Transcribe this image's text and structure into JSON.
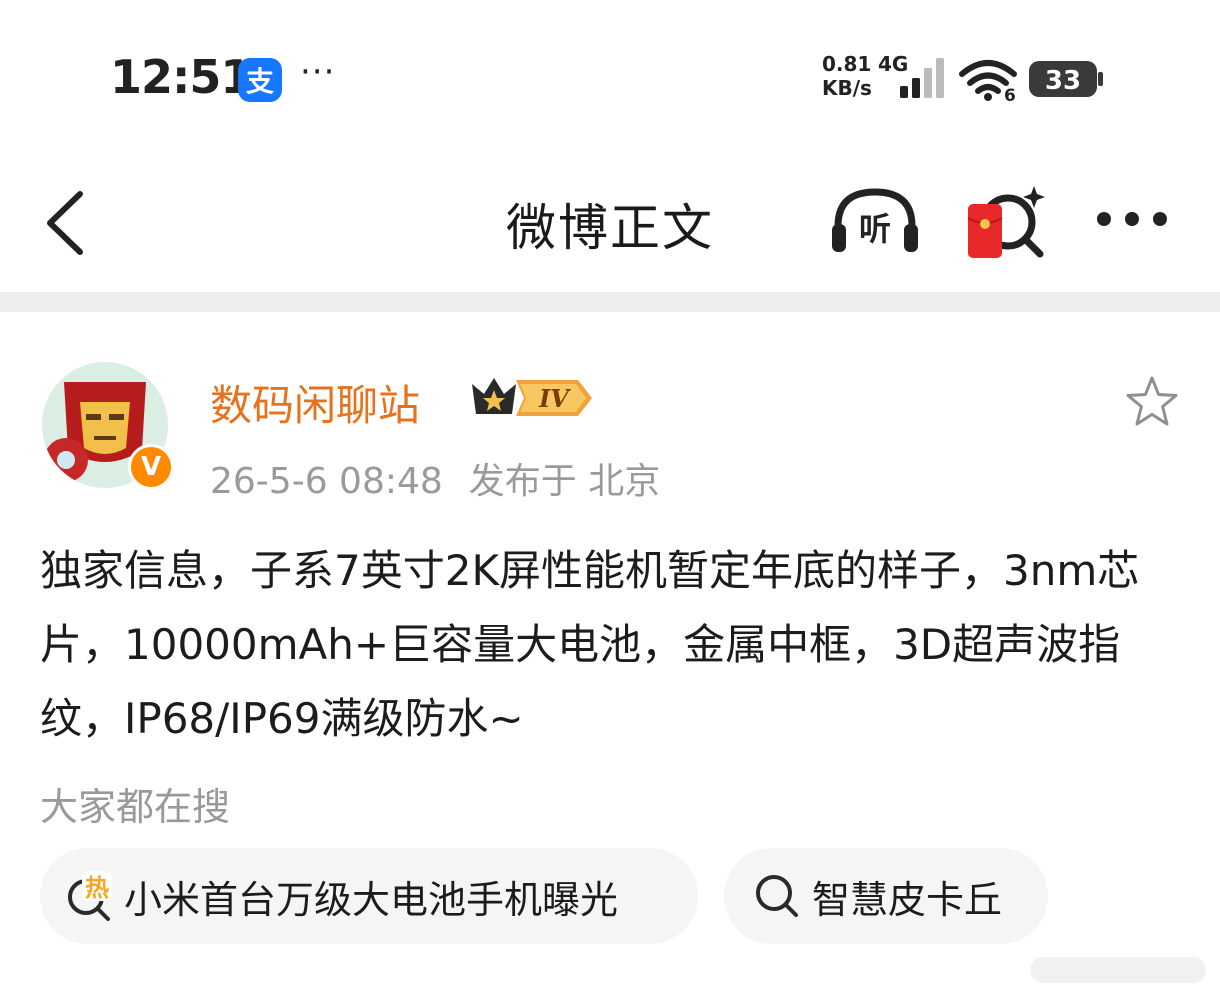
{
  "status_bar": {
    "time": "12:51",
    "app_icon_glyph": "支",
    "overflow": "···",
    "net_speed_value": "0.81",
    "net_speed_unit": "KB/s",
    "network_type": "4G",
    "wifi_band": "6",
    "battery_level": "33"
  },
  "nav": {
    "title": "微博正文",
    "listen_label": "听",
    "icons": [
      "back-arrow-icon",
      "listen-headphones-icon",
      "red-packet-search-icon",
      "more-dots-icon"
    ]
  },
  "post": {
    "username": "数码闲聊站",
    "level": "IV",
    "verified_mark": "V",
    "timestamp": "26-5-6 08:48",
    "location": "发布于 北京",
    "text": "独家信息，子系7英寸2K屏性能机暂定年底的样子，3nm芯片，10000mAh+巨容量大电池，金属中框，3D超声波指纹，IP68/IP69满级防水~"
  },
  "searches": {
    "label": "大家都在搜",
    "hot_badge": "热",
    "items": [
      "小米首台万级大电池手机曝光",
      "智慧皮卡丘"
    ]
  },
  "colors": {
    "username": "#e8721c",
    "meta": "#9a9a9a",
    "chip_bg": "#f5f5f5",
    "divider": "#eeeeee",
    "verified_badge": "#ff8a00",
    "red_packet": "#e8292c",
    "hot": "#f5a623"
  }
}
